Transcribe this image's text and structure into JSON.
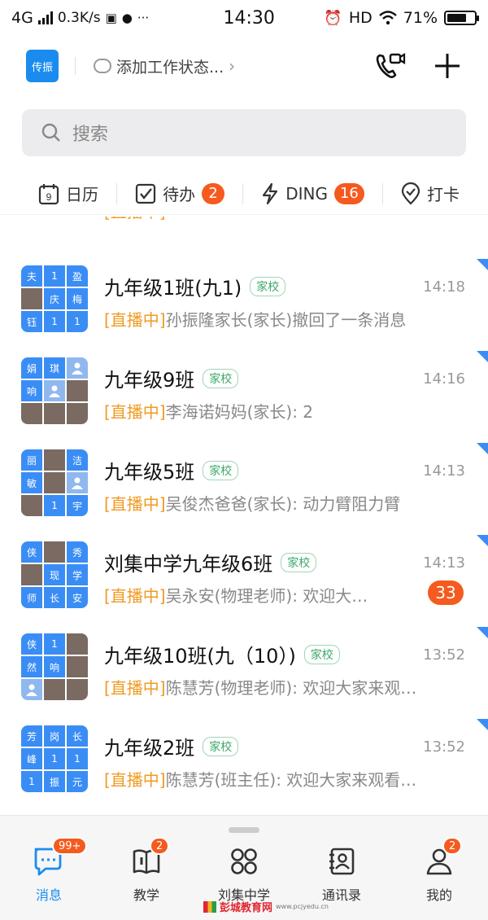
{
  "status_bar": {
    "network": "4G",
    "speed": "0.3K/s",
    "time": "14:30",
    "hd": "HD",
    "battery": "71%",
    "battery_level": 0.71
  },
  "header": {
    "logo_text": "传振",
    "work_status": "添加工作状态..."
  },
  "search": {
    "placeholder": "搜索"
  },
  "quickbar": {
    "calendar": {
      "label": "日历",
      "day": "9"
    },
    "todo": {
      "label": "待办",
      "badge": "2"
    },
    "ding": {
      "label": "DING",
      "badge": "16"
    },
    "checkin": {
      "label": "打卡"
    }
  },
  "chats": [
    {
      "name": "九年级1班(九1)",
      "tag": "家校",
      "time": "14:18",
      "live": "[直播中]",
      "message": "孙振隆家长(家长)撤回了一条消息",
      "cells": [
        "夫",
        "1",
        "盈",
        "@photo",
        "庆",
        "梅",
        "钰",
        "1",
        "1"
      ]
    },
    {
      "name": "九年级9班",
      "tag": "家校",
      "time": "14:16",
      "live": "[直播中]",
      "message": "李海诺妈妈(家长): 2",
      "cells": [
        "娟",
        "琪",
        "@person",
        "响",
        "@person",
        "@photo",
        "@photo",
        "@photo",
        "@photo"
      ]
    },
    {
      "name": "九年级5班",
      "tag": "家校",
      "time": "14:13",
      "live": "[直播中]",
      "message": "吴俊杰爸爸(家长): 动力臂阻力臂",
      "cells": [
        "丽",
        "@photo",
        "洁",
        "敏",
        "@photo",
        "@person",
        "@photo",
        "1",
        "宇"
      ]
    },
    {
      "name": "刘集中学九年级6班",
      "tag": "家校",
      "time": "14:13",
      "live": "[直播中]",
      "message": "吴永安(物理老师): 欢迎大…",
      "badge": "33",
      "cells": [
        "侠",
        "@photo",
        "秀",
        "@photo",
        "现",
        "学",
        "师",
        "长",
        "安"
      ]
    },
    {
      "name": "九年级10班(九（10）)",
      "tag": "家校",
      "time": "13:52",
      "live": "[直播中]",
      "message": "陈慧芳(物理老师): 欢迎大家来观…",
      "cells": [
        "侠",
        "1",
        "@photo",
        "然",
        "响",
        "@photo",
        "@person",
        "@photo",
        "@photo"
      ]
    },
    {
      "name": "九年级2班",
      "tag": "家校",
      "time": "13:52",
      "live": "[直播中]",
      "message": "陈慧芳(班主任): 欢迎大家来观看…",
      "cells": [
        "芳",
        "岗",
        "长",
        "峰",
        "1",
        "1",
        "1",
        "振",
        "元"
      ]
    }
  ],
  "tabs": [
    {
      "label": "消息",
      "badge": "99+",
      "icon": "chat-icon",
      "active": true
    },
    {
      "label": "教学",
      "badge": "2",
      "icon": "book-icon"
    },
    {
      "label": "刘集中学",
      "icon": "grid-icon"
    },
    {
      "label": "通讯录",
      "icon": "contacts-icon"
    },
    {
      "label": "我的",
      "badge": "2",
      "icon": "user-icon"
    }
  ],
  "watermark": {
    "text": "彭城教育网",
    "url": "www.pcjyedu.cn"
  },
  "colors": {
    "accent": "#1a8cf0",
    "badge": "#f55a1e",
    "live": "#f09a23",
    "tag": "#3aa869"
  }
}
